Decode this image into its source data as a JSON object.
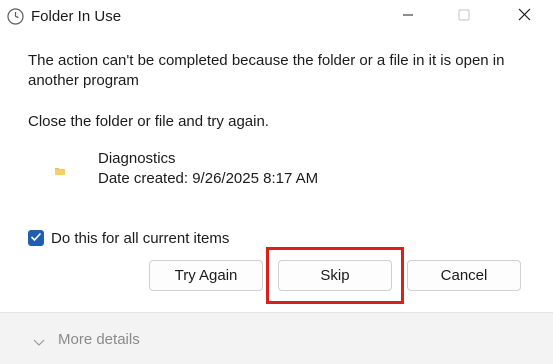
{
  "window": {
    "title": "Folder In Use",
    "icon": "clock-icon"
  },
  "titlebar_buttons": {
    "minimize_icon": "minimize-icon",
    "maximize_icon": "maximize-icon",
    "close_icon": "close-icon"
  },
  "message": {
    "line1": "The action can't be completed because the folder or a file in it is open in another program",
    "line2": "Close the folder or file and try again."
  },
  "item": {
    "icon": "folder-icon",
    "name": "Diagnostics",
    "date_created": "Date created: 9/26/2025 8:17 AM"
  },
  "checkbox": {
    "label": "Do this for all current items",
    "checked": true
  },
  "buttons": {
    "try_again": "Try Again",
    "skip": "Skip",
    "cancel": "Cancel"
  },
  "footer": {
    "more_details": "More details"
  },
  "colors": {
    "accent": "#1f5fae",
    "highlight": "#d8201c"
  }
}
